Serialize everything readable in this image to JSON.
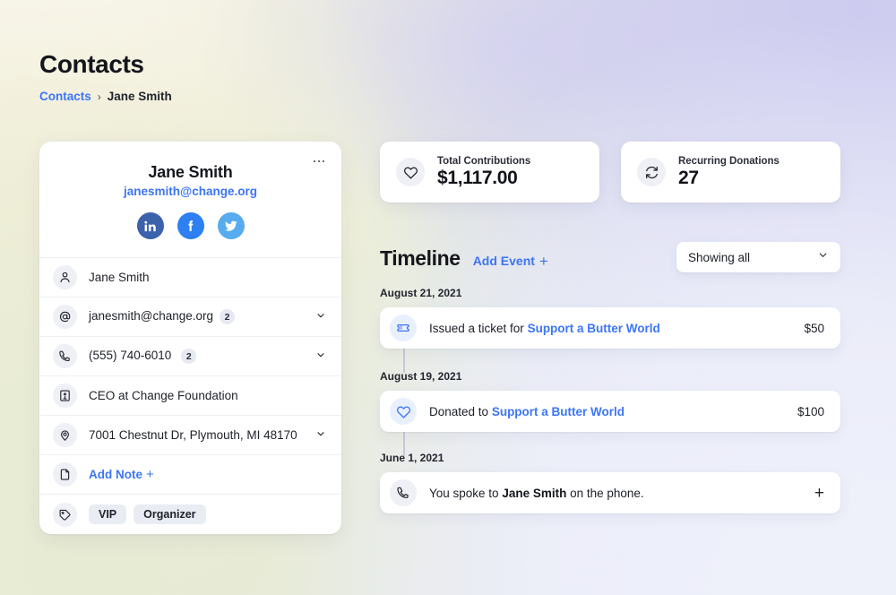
{
  "header": {
    "title": "Contacts",
    "breadcrumb": {
      "root": "Contacts",
      "separator": "›",
      "current": "Jane Smith"
    }
  },
  "contact_card": {
    "more_menu": "more-options",
    "name": "Jane Smith",
    "email": "janesmith@change.org",
    "socials": [
      {
        "name": "linkedin",
        "label": "in",
        "color": "#3c62ab"
      },
      {
        "name": "facebook",
        "label": "f",
        "color": "#2d7ff2"
      },
      {
        "name": "twitter",
        "label": "t",
        "color": "#56acee"
      }
    ],
    "rows": [
      {
        "icon": "person-icon",
        "text": "Jane Smith",
        "badge": null,
        "chevron": false,
        "link": false
      },
      {
        "icon": "at-sign-icon",
        "text": "janesmith@change.org",
        "badge": "2",
        "chevron": true,
        "link": false
      },
      {
        "icon": "phone-icon",
        "text": "(555) 740-6010",
        "badge": "2",
        "chevron": true,
        "link": false
      },
      {
        "icon": "building-icon",
        "text": "CEO at Change Foundation",
        "badge": null,
        "chevron": false,
        "link": false
      },
      {
        "icon": "map-pin-icon",
        "text": "7001 Chestnut Dr, Plymouth, MI 48170",
        "badge": null,
        "chevron": true,
        "link": false
      },
      {
        "icon": "document-icon",
        "text": "Add Note",
        "badge": null,
        "chevron": false,
        "link": true,
        "plus": "+"
      }
    ],
    "tags_row": {
      "icon": "tag-icon",
      "chips": [
        "VIP",
        "Organizer"
      ]
    }
  },
  "stats": [
    {
      "icon": "heart-icon",
      "label": "Total Contributions",
      "value": "$1,117.00"
    },
    {
      "icon": "refresh-cycle-icon",
      "label": "Recurring Donations",
      "value": "27"
    }
  ],
  "timeline": {
    "title": "Timeline",
    "add_event_label": "Add Event",
    "add_event_plus": "+",
    "filter": {
      "value": "Showing all",
      "chevron": "chevron-down-icon"
    },
    "groups": [
      {
        "date": "August 21, 2021",
        "events": [
          {
            "icon": "ticket-icon",
            "icon_style": "blue",
            "text_before": "Issued a ticket for ",
            "link": "Support a Butter World",
            "text_after": "",
            "amount": "$50",
            "action": null
          }
        ]
      },
      {
        "date": "August 19, 2021",
        "events": [
          {
            "icon": "heart-icon",
            "icon_style": "blue",
            "text_before": "Donated to ",
            "link": "Support a Butter World",
            "text_after": "",
            "amount": "$100",
            "action": null
          }
        ]
      },
      {
        "date": "June 1, 2021",
        "events": [
          {
            "icon": "phone-icon",
            "icon_style": "grey",
            "text_before": "You spoke to ",
            "strong": "Jane Smith",
            "text_after": " on the phone.",
            "amount": null,
            "action": "+"
          }
        ]
      }
    ]
  },
  "colors": {
    "accent_blue": "#3b76f6",
    "text_dark": "#15161c",
    "card_bg": "#ffffff",
    "icon_bubble": "#eef0f6",
    "icon_bubble_blue": "#e8f0fe",
    "chip_bg": "#e9ecf3",
    "bg_top_left": "#fbf6f3",
    "bg_top_right": "#cdcbef",
    "bg_bottom_left": "#e7ebd4",
    "bg_bottom_right": "#eef0fa"
  }
}
